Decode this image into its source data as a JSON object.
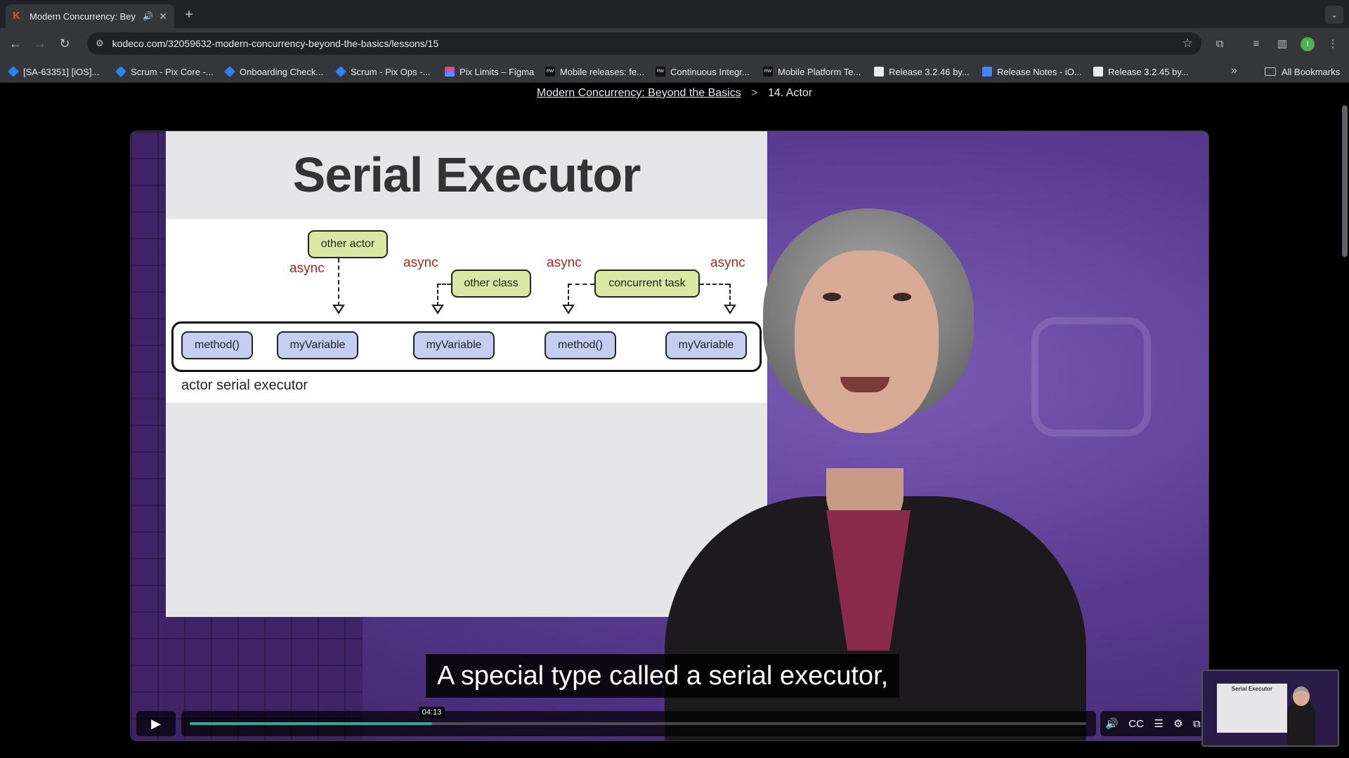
{
  "browser": {
    "tab": {
      "title": "Modern Concurrency: Bey",
      "favicon": "kodeco-icon"
    },
    "url": "kodeco.com/32059632-modern-concurrency-beyond-the-basics/lessons/15",
    "profile_initial": "I",
    "bookmarks": [
      {
        "label": "[SA-63351] [iOS]...",
        "icon": "jira-icon"
      },
      {
        "label": "Scrum - Pix Core -...",
        "icon": "jira-icon"
      },
      {
        "label": "Onboarding Check...",
        "icon": "jira-icon"
      },
      {
        "label": "Scrum - Pix Ops -...",
        "icon": "jira-icon"
      },
      {
        "label": "Pix Limits – Figma",
        "icon": "figma-icon"
      },
      {
        "label": "Mobile releases: fe...",
        "icon": "rw-icon"
      },
      {
        "label": "Continuous Integr...",
        "icon": "rw-icon"
      },
      {
        "label": "Mobile Platform Te...",
        "icon": "rw-icon"
      },
      {
        "label": "Release 3.2.46 by...",
        "icon": "github-icon"
      },
      {
        "label": "Release Notes - iO...",
        "icon": "docs-icon"
      },
      {
        "label": "Release 3.2.45 by...",
        "icon": "github-icon"
      }
    ],
    "all_bookmarks": "All Bookmarks"
  },
  "breadcrumb": {
    "course": "Modern Concurrency: Beyond the Basics",
    "separator": ">",
    "lesson": "14. Actor"
  },
  "slide": {
    "title": "Serial Executor",
    "callers": [
      {
        "label": "other actor"
      },
      {
        "label": "other class"
      },
      {
        "label": "concurrent task"
      }
    ],
    "async_labels": [
      "async",
      "async",
      "async",
      "async"
    ],
    "executor_items": [
      "method()",
      "myVariable",
      "myVariable",
      "method()",
      "myVariable"
    ],
    "executor_label": "actor serial executor"
  },
  "caption": "A special type called a serial executor,",
  "player": {
    "current_time": "04:13",
    "progress_fraction": 0.27,
    "accent_color": "#19b394",
    "controls": [
      "play-icon",
      "volume-icon",
      "captions-icon",
      "transcript-icon",
      "settings-icon",
      "pip-icon"
    ]
  },
  "pip": {
    "title": "Serial Executor"
  }
}
